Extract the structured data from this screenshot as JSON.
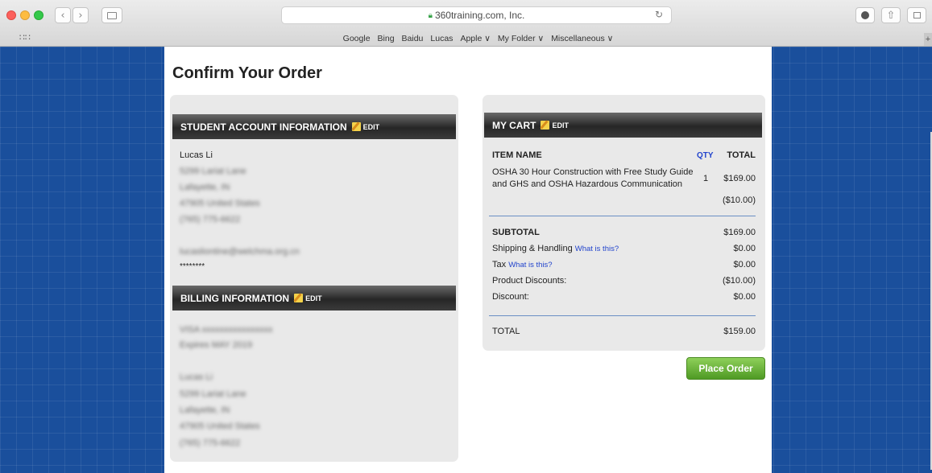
{
  "browser": {
    "address": "360training.com, Inc.",
    "bookmarks": [
      "Google",
      "Bing",
      "Baidu",
      "Lucas",
      "Apple ∨",
      "My Folder ∨",
      "Miscellaneous ∨"
    ]
  },
  "page": {
    "title": "Confirm Your Order"
  },
  "student_account": {
    "header": "STUDENT ACCOUNT INFORMATION",
    "edit_label": "EDIT",
    "name": "Lucas Li",
    "street": "5299 Lariat Lane",
    "city": "Lafayette, IN",
    "zip_country": "47905 United States",
    "phone": "(765) 775-6622",
    "email": "lucasliontine@welchma.org.cn",
    "password": "********"
  },
  "billing": {
    "header": "BILLING INFORMATION",
    "edit_label": "EDIT",
    "card": "VISA xxxxxxxxxxxxxxxx",
    "expires": "Expires MAY 2019",
    "name": "Lucas Li",
    "street": "5299 Lariat Lane",
    "city": "Lafayette, IN",
    "zip_country": "47905 United States",
    "phone": "(765) 775-6622"
  },
  "cart": {
    "header": "MY CART",
    "edit_label": "EDIT",
    "col_item": "ITEM NAME",
    "col_qty": "QTY",
    "col_total": "TOTAL",
    "item_line1": "OSHA 30 Hour Construction with Free Study Guide",
    "item_line2": "and GHS and OSHA Hazardous Communication",
    "item_qty": "1",
    "item_total": "$169.00",
    "item_discount": "($10.00)",
    "subtotal_label": "SUBTOTAL",
    "subtotal_value": "$169.00",
    "shipping_label": "Shipping & Handling",
    "shipping_link": "What is this?",
    "shipping_value": "$0.00",
    "tax_label": "Tax",
    "tax_link": "What is this?",
    "tax_value": "$0.00",
    "product_discounts_label": "Product Discounts:",
    "product_discounts_value": "($10.00)",
    "discount_label": "Discount:",
    "discount_value": "$0.00",
    "total_label": "TOTAL",
    "total_value": "$159.00"
  },
  "actions": {
    "place_order": "Place Order"
  }
}
